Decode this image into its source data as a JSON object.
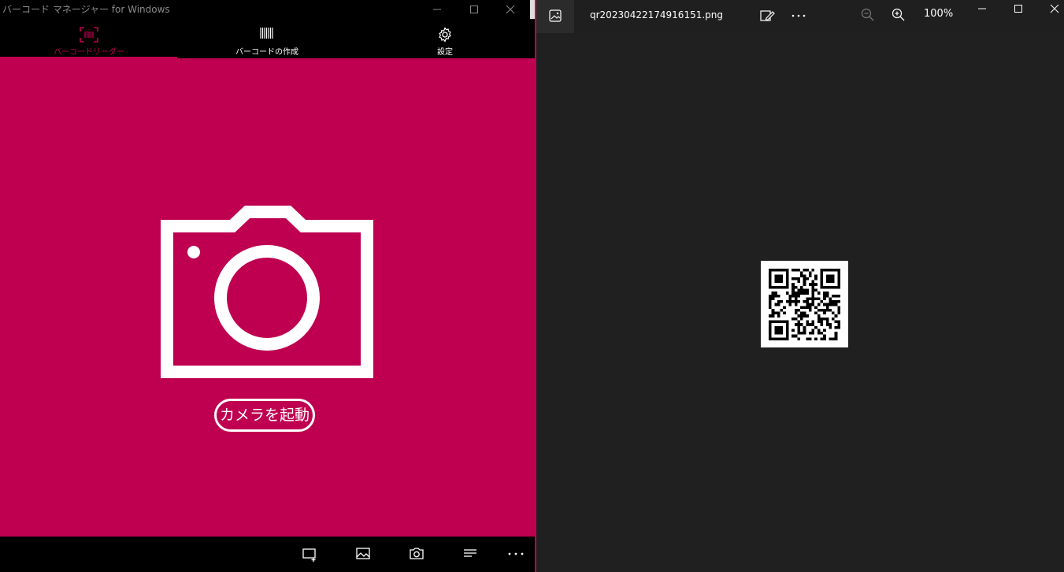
{
  "left_window": {
    "title": "バーコード マネージャー for Windows",
    "tabs": [
      {
        "label": "バーコードリーダー",
        "icon": "barcode-scan-icon",
        "active": true
      },
      {
        "label": "バーコードの作成",
        "icon": "barcode-icon",
        "active": false
      },
      {
        "label": "設定",
        "icon": "gear-icon",
        "active": false
      }
    ],
    "accent_color": "#c0004f",
    "panel_color": "#bf0050",
    "launch_button_label": "カメラを起動",
    "command_bar": [
      {
        "icon": "select-area-icon"
      },
      {
        "icon": "image-icon"
      },
      {
        "icon": "camera-icon"
      },
      {
        "icon": "list-icon"
      },
      {
        "icon": "more-icon"
      }
    ]
  },
  "right_window": {
    "file_name": "qr20230422174916151.png",
    "zoom_level": "100%",
    "image": "qr-code-image"
  }
}
